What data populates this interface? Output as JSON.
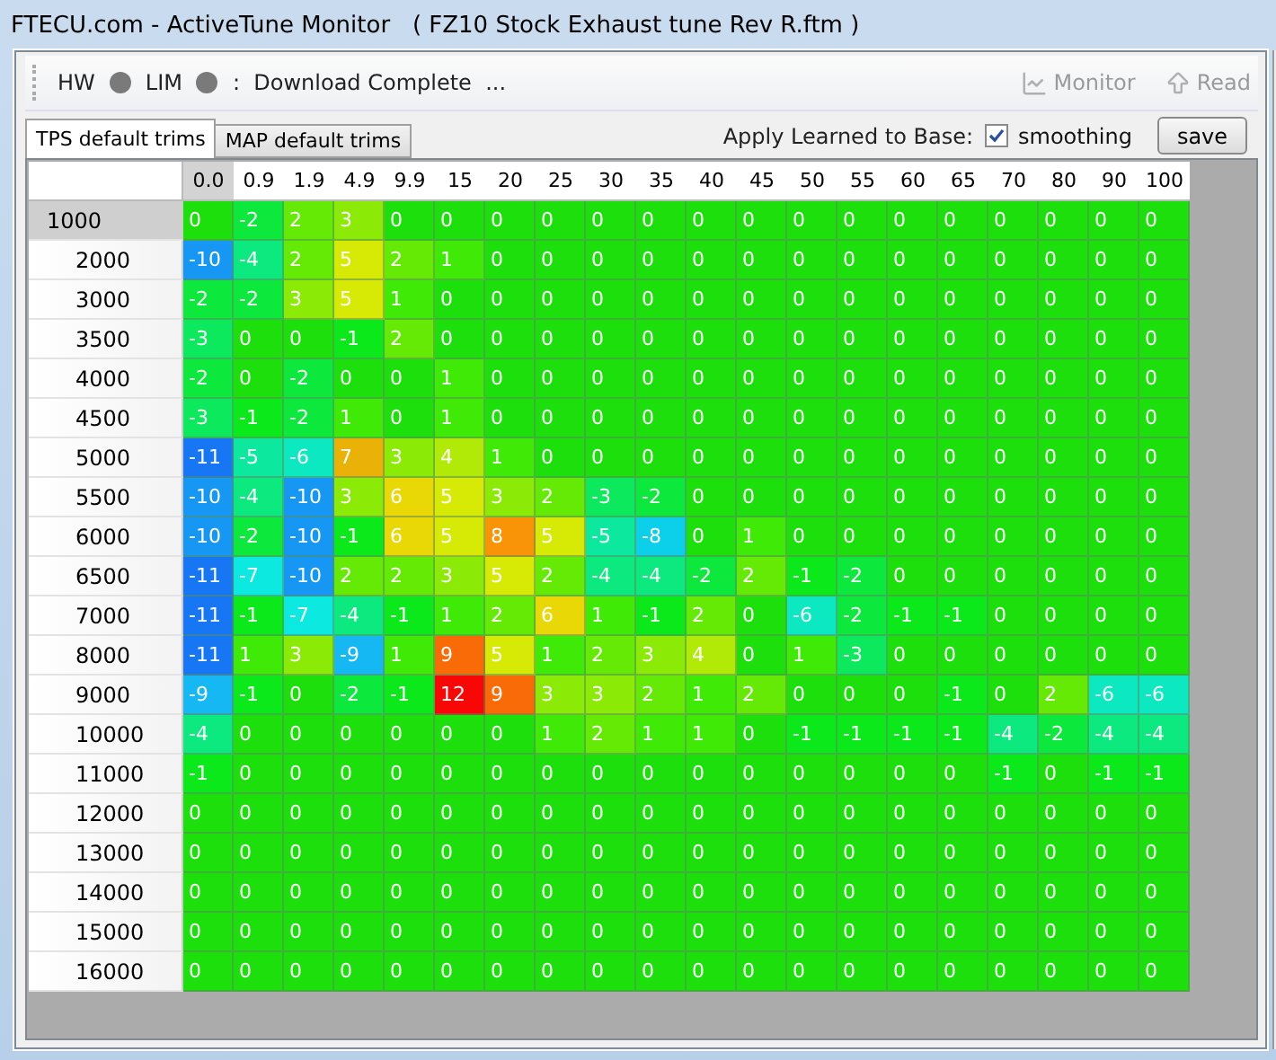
{
  "window": {
    "title": "FTECU.com - ActiveTune Monitor   ( FZ10 Stock Exhaust tune Rev R.ftm )"
  },
  "toolbar": {
    "indicators": [
      {
        "label": "HW"
      },
      {
        "label": "LIM"
      }
    ],
    "status": ":  Download Complete  ...",
    "buttons": [
      {
        "label": "Monitor",
        "disabled": true,
        "kind": "chart"
      },
      {
        "label": "Read",
        "disabled": true,
        "kind": "upload"
      }
    ]
  },
  "tabs": [
    {
      "label": "TPS default trims",
      "selected": true
    },
    {
      "label": "MAP default trims",
      "selected": false
    }
  ],
  "apply": {
    "label": "Apply Learned to Base:",
    "smoothing": {
      "label": "smoothing",
      "checked": true
    },
    "save": "save"
  },
  "table": {
    "columns": [
      {
        "label": "0.0",
        "selected": true
      },
      {
        "label": "0.9",
        "selected": false
      },
      {
        "label": "1.9",
        "selected": false
      },
      {
        "label": "4.9",
        "selected": false
      },
      {
        "label": "9.9",
        "selected": false
      },
      {
        "label": "15",
        "selected": false
      },
      {
        "label": "20",
        "selected": false
      },
      {
        "label": "25",
        "selected": false
      },
      {
        "label": "30",
        "selected": false
      },
      {
        "label": "35",
        "selected": false
      },
      {
        "label": "40",
        "selected": false
      },
      {
        "label": "45",
        "selected": false
      },
      {
        "label": "50",
        "selected": false
      },
      {
        "label": "55",
        "selected": false
      },
      {
        "label": "60",
        "selected": false
      },
      {
        "label": "65",
        "selected": false
      },
      {
        "label": "70",
        "selected": false
      },
      {
        "label": "80",
        "selected": false
      },
      {
        "label": "90",
        "selected": false
      },
      {
        "label": "100",
        "selected": false
      }
    ],
    "rows": [
      {
        "label": "1000",
        "selected": true,
        "cells": [
          "0",
          "-2",
          "2",
          "3",
          "0",
          "0",
          "0",
          "0",
          "0",
          "0",
          "0",
          "0",
          "0",
          "0",
          "0",
          "0",
          "0",
          "0",
          "0",
          "0"
        ]
      },
      {
        "label": "2000",
        "selected": false,
        "cells": [
          "-10",
          "-4",
          "2",
          "5",
          "2",
          "1",
          "0",
          "0",
          "0",
          "0",
          "0",
          "0",
          "0",
          "0",
          "0",
          "0",
          "0",
          "0",
          "0",
          "0"
        ]
      },
      {
        "label": "3000",
        "selected": false,
        "cells": [
          "-2",
          "-2",
          "3",
          "5",
          "1",
          "0",
          "0",
          "0",
          "0",
          "0",
          "0",
          "0",
          "0",
          "0",
          "0",
          "0",
          "0",
          "0",
          "0",
          "0"
        ]
      },
      {
        "label": "3500",
        "selected": false,
        "cells": [
          "-3",
          "0",
          "0",
          "-1",
          "2",
          "0",
          "0",
          "0",
          "0",
          "0",
          "0",
          "0",
          "0",
          "0",
          "0",
          "0",
          "0",
          "0",
          "0",
          "0"
        ]
      },
      {
        "label": "4000",
        "selected": false,
        "cells": [
          "-2",
          "0",
          "-2",
          "0",
          "0",
          "1",
          "0",
          "0",
          "0",
          "0",
          "0",
          "0",
          "0",
          "0",
          "0",
          "0",
          "0",
          "0",
          "0",
          "0"
        ]
      },
      {
        "label": "4500",
        "selected": false,
        "cells": [
          "-3",
          "-1",
          "-2",
          "1",
          "0",
          "1",
          "0",
          "0",
          "0",
          "0",
          "0",
          "0",
          "0",
          "0",
          "0",
          "0",
          "0",
          "0",
          "0",
          "0"
        ]
      },
      {
        "label": "5000",
        "selected": false,
        "cells": [
          "-11",
          "-5",
          "-6",
          "7",
          "3",
          "4",
          "1",
          "0",
          "0",
          "0",
          "0",
          "0",
          "0",
          "0",
          "0",
          "0",
          "0",
          "0",
          "0",
          "0"
        ]
      },
      {
        "label": "5500",
        "selected": false,
        "cells": [
          "-10",
          "-4",
          "-10",
          "3",
          "6",
          "5",
          "3",
          "2",
          "-3",
          "-2",
          "0",
          "0",
          "0",
          "0",
          "0",
          "0",
          "0",
          "0",
          "0",
          "0"
        ]
      },
      {
        "label": "6000",
        "selected": false,
        "cells": [
          "-10",
          "-2",
          "-10",
          "-1",
          "6",
          "5",
          "8",
          "5",
          "-5",
          "-8",
          "0",
          "1",
          "0",
          "0",
          "0",
          "0",
          "0",
          "0",
          "0",
          "0"
        ]
      },
      {
        "label": "6500",
        "selected": false,
        "cells": [
          "-11",
          "-7",
          "-10",
          "2",
          "2",
          "3",
          "5",
          "2",
          "-4",
          "-4",
          "-2",
          "2",
          "-1",
          "-2",
          "0",
          "0",
          "0",
          "0",
          "0",
          "0"
        ]
      },
      {
        "label": "7000",
        "selected": false,
        "cells": [
          "-11",
          "-1",
          "-7",
          "-4",
          "-1",
          "1",
          "2",
          "6",
          "1",
          "-1",
          "2",
          "0",
          "-6",
          "-2",
          "-1",
          "-1",
          "0",
          "0",
          "0",
          "0"
        ]
      },
      {
        "label": "8000",
        "selected": false,
        "cells": [
          "-11",
          "1",
          "3",
          "-9",
          "1",
          "9",
          "5",
          "1",
          "2",
          "3",
          "4",
          "0",
          "1",
          "-3",
          "0",
          "0",
          "0",
          "0",
          "0",
          "0"
        ]
      },
      {
        "label": "9000",
        "selected": false,
        "cells": [
          "-9",
          "-1",
          "0",
          "-2",
          "-1",
          "12",
          "9",
          "3",
          "3",
          "2",
          "1",
          "2",
          "0",
          "0",
          "0",
          "-1",
          "0",
          "2",
          "-6",
          "-6"
        ]
      },
      {
        "label": "10000",
        "selected": false,
        "cells": [
          "-4",
          "0",
          "0",
          "0",
          "0",
          "0",
          "0",
          "1",
          "2",
          "1",
          "1",
          "0",
          "-1",
          "-1",
          "-1",
          "-1",
          "-4",
          "-2",
          "-4",
          "-4"
        ]
      },
      {
        "label": "11000",
        "selected": false,
        "cells": [
          "-1",
          "0",
          "0",
          "0",
          "0",
          "0",
          "0",
          "0",
          "0",
          "0",
          "0",
          "0",
          "0",
          "0",
          "0",
          "0",
          "-1",
          "0",
          "-1",
          "-1"
        ]
      },
      {
        "label": "12000",
        "selected": false,
        "cells": [
          "0",
          "0",
          "0",
          "0",
          "0",
          "0",
          "0",
          "0",
          "0",
          "0",
          "0",
          "0",
          "0",
          "0",
          "0",
          "0",
          "0",
          "0",
          "0",
          "0"
        ]
      },
      {
        "label": "13000",
        "selected": false,
        "cells": [
          "0",
          "0",
          "0",
          "0",
          "0",
          "0",
          "0",
          "0",
          "0",
          "0",
          "0",
          "0",
          "0",
          "0",
          "0",
          "0",
          "0",
          "0",
          "0",
          "0"
        ]
      },
      {
        "label": "14000",
        "selected": false,
        "cells": [
          "0",
          "0",
          "0",
          "0",
          "0",
          "0",
          "0",
          "0",
          "0",
          "0",
          "0",
          "0",
          "0",
          "0",
          "0",
          "0",
          "0",
          "0",
          "0",
          "0"
        ]
      },
      {
        "label": "15000",
        "selected": false,
        "cells": [
          "0",
          "0",
          "0",
          "0",
          "0",
          "0",
          "0",
          "0",
          "0",
          "0",
          "0",
          "0",
          "0",
          "0",
          "0",
          "0",
          "0",
          "0",
          "0",
          "0"
        ]
      },
      {
        "label": "16000",
        "selected": false,
        "cells": [
          "0",
          "0",
          "0",
          "0",
          "0",
          "0",
          "0",
          "0",
          "0",
          "0",
          "0",
          "0",
          "0",
          "0",
          "0",
          "0",
          "0",
          "0",
          "0",
          "0"
        ]
      }
    ]
  }
}
